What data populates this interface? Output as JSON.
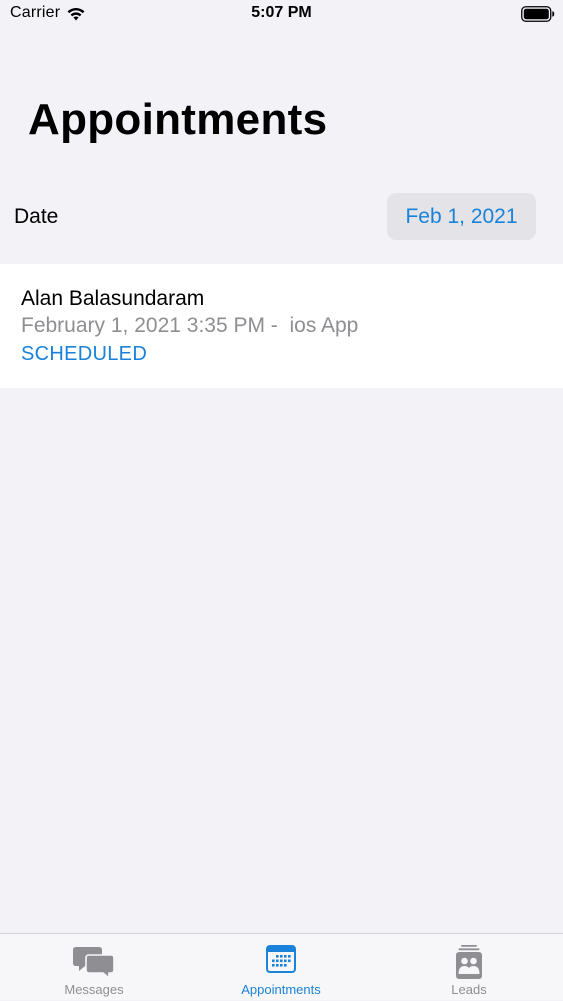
{
  "status_bar": {
    "carrier": "Carrier",
    "time": "5:07 PM",
    "wifi_icon": "wifi-icon",
    "battery_icon": "battery-full-icon"
  },
  "header": {
    "title": "Appointments"
  },
  "date_filter": {
    "label": "Date",
    "value": "Feb 1, 2021"
  },
  "appointments": [
    {
      "name": "Alan Balasundaram",
      "details": "February 1, 2021 3:35 PM -  ios App",
      "status": "SCHEDULED"
    }
  ],
  "tab_bar": {
    "tabs": [
      {
        "label": "Messages",
        "icon": "chat-bubbles-icon",
        "active": false
      },
      {
        "label": "Appointments",
        "icon": "calendar-icon",
        "active": true
      },
      {
        "label": "Leads",
        "icon": "contacts-card-icon",
        "active": false
      }
    ]
  },
  "colors": {
    "accent": "#1a82d8",
    "background": "#f2f2f7",
    "secondary_text": "#8e8e93",
    "picker_background": "#e3e3e8"
  }
}
